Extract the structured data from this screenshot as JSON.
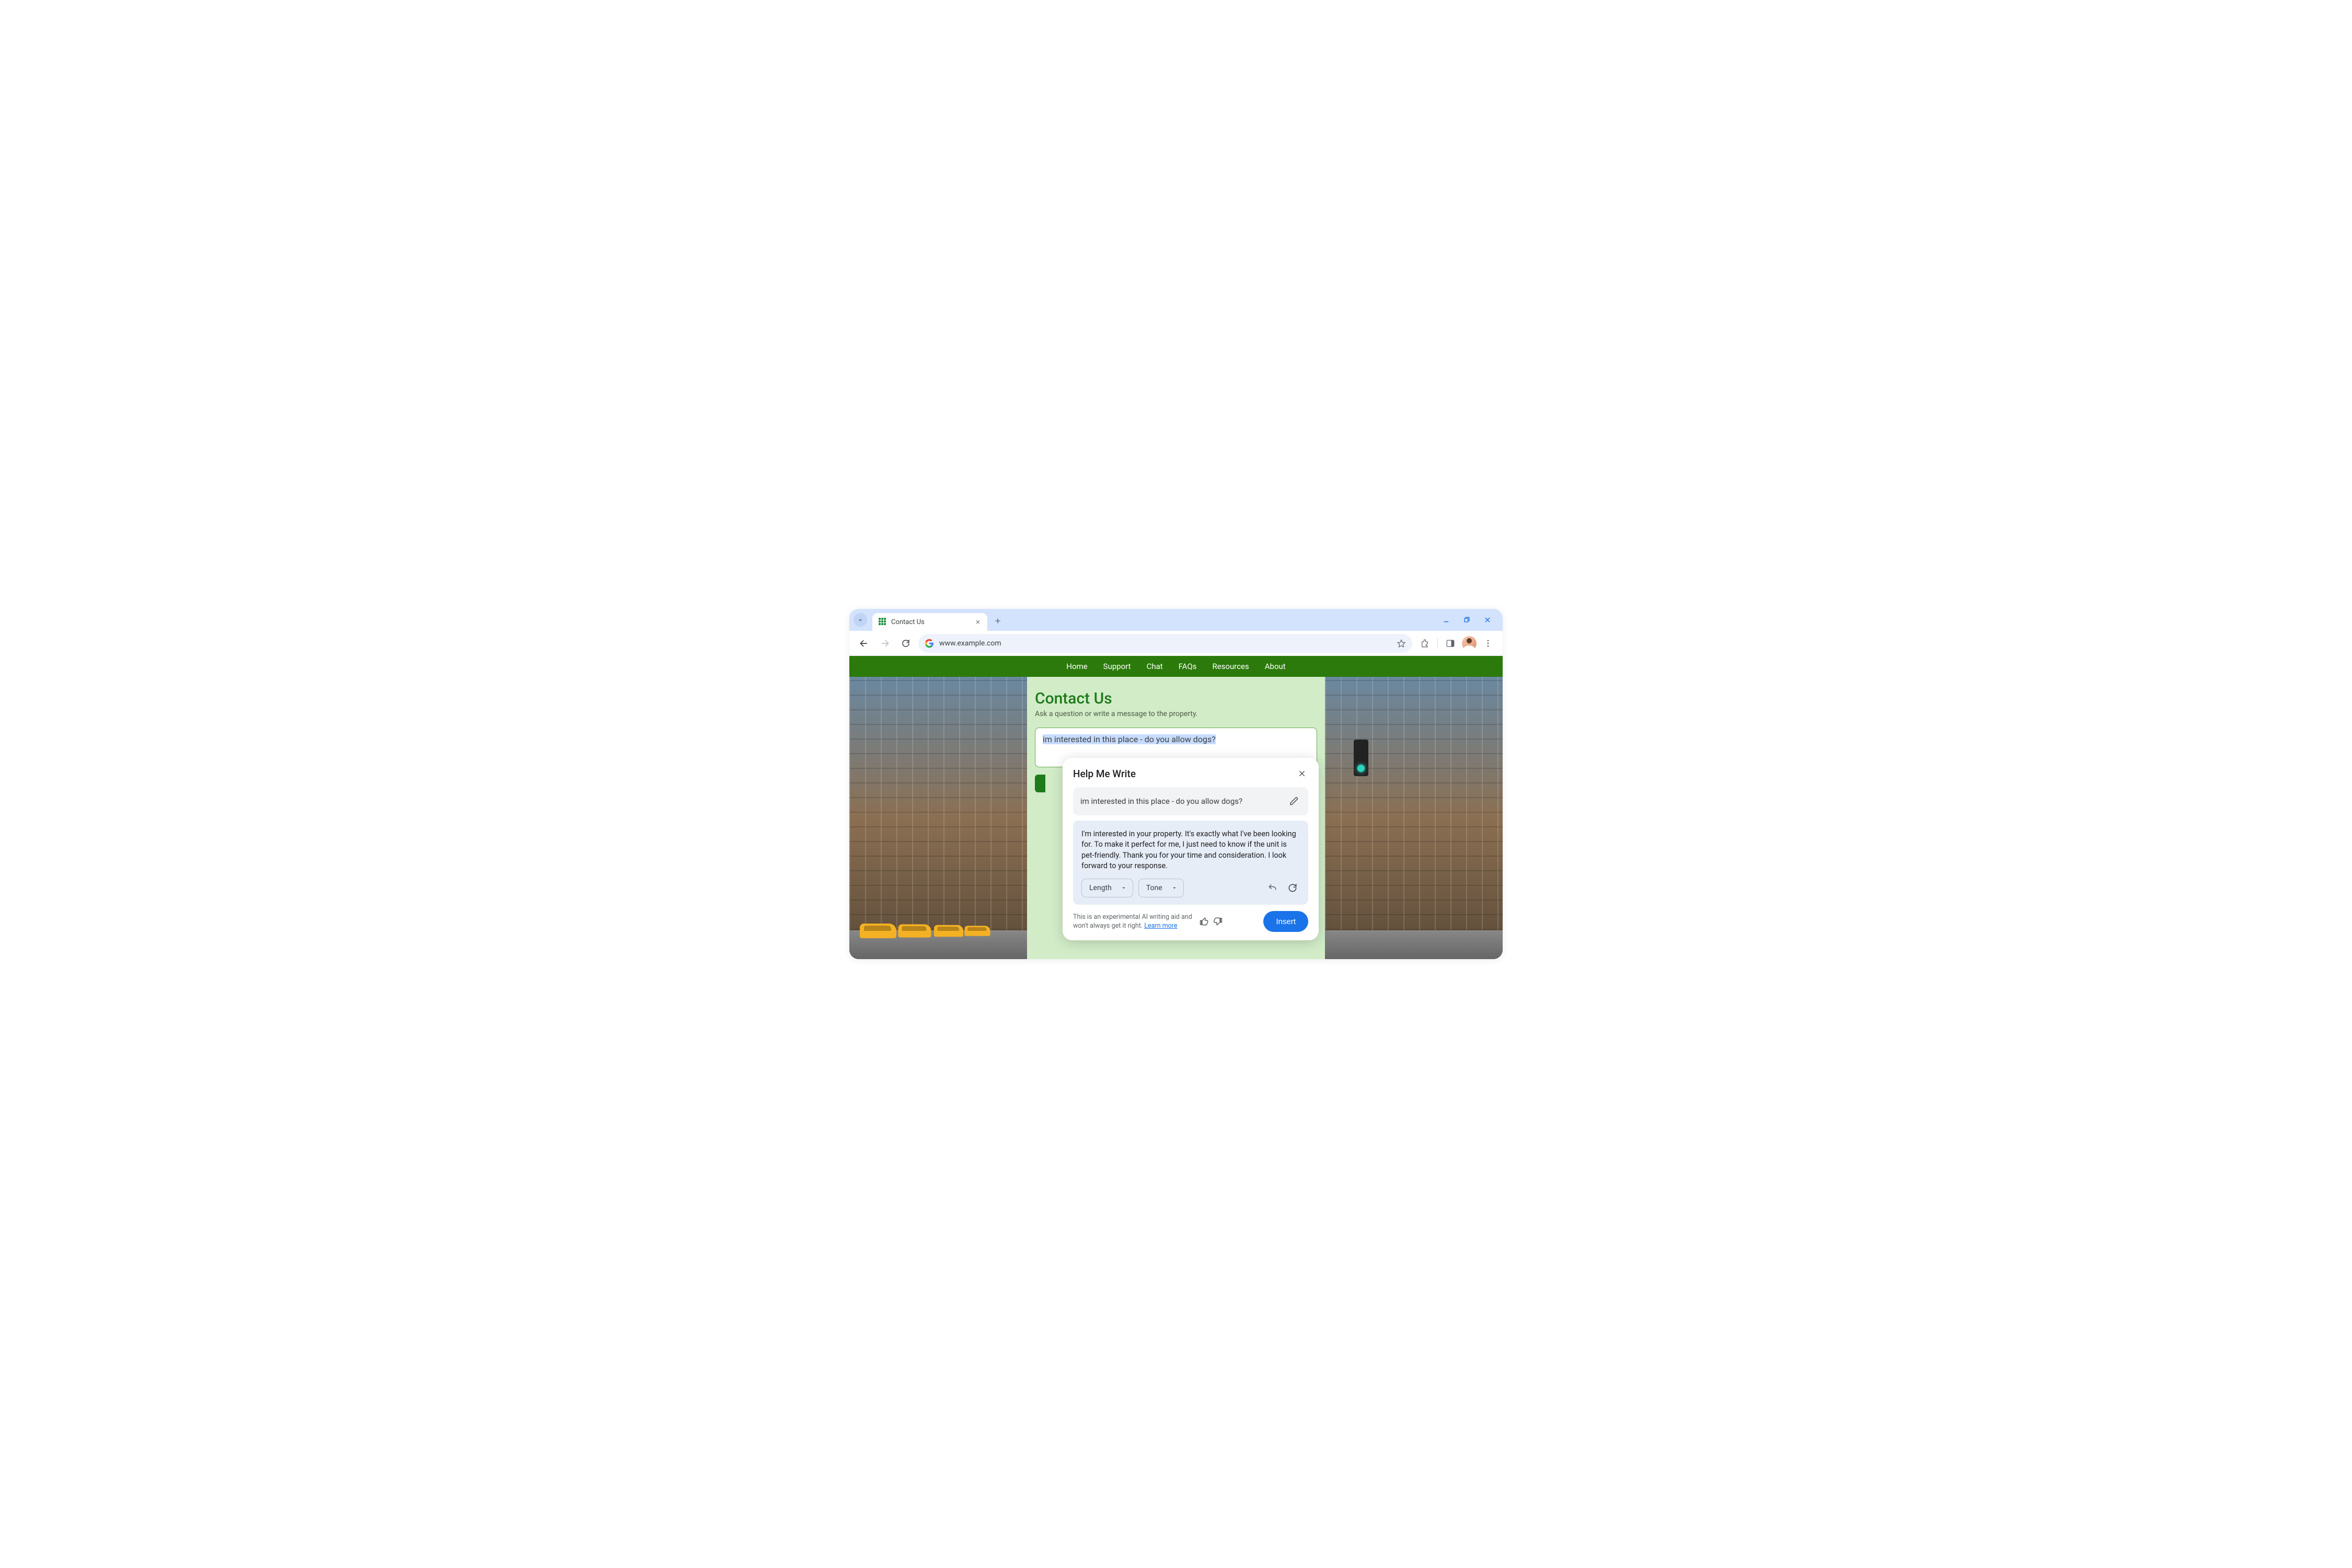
{
  "browser": {
    "tab_title": "Contact Us",
    "url": "www.example.com"
  },
  "nav": {
    "items": [
      "Home",
      "Support",
      "Chat",
      "FAQs",
      "Resources",
      "About"
    ]
  },
  "content": {
    "title": "Contact Us",
    "subtitle": "Ask a question or write a message to the property.",
    "message_input": "im interested in this place - do you allow dogs?"
  },
  "popup": {
    "title": "Help Me Write",
    "prompt": "im interested in this place - do you allow dogs?",
    "result": "I'm interested in your property. It's exactly what I've been looking for. To make it perfect for me, I just need to know if the unit is pet-friendly. Thank you for your time and consideration. I look forward to your response.",
    "chip_length": "Length",
    "chip_tone": "Tone",
    "disclaimer_a": "This is an experimental AI writing aid and won't always get it right. ",
    "learn_more": "Learn more",
    "insert": "Insert"
  }
}
